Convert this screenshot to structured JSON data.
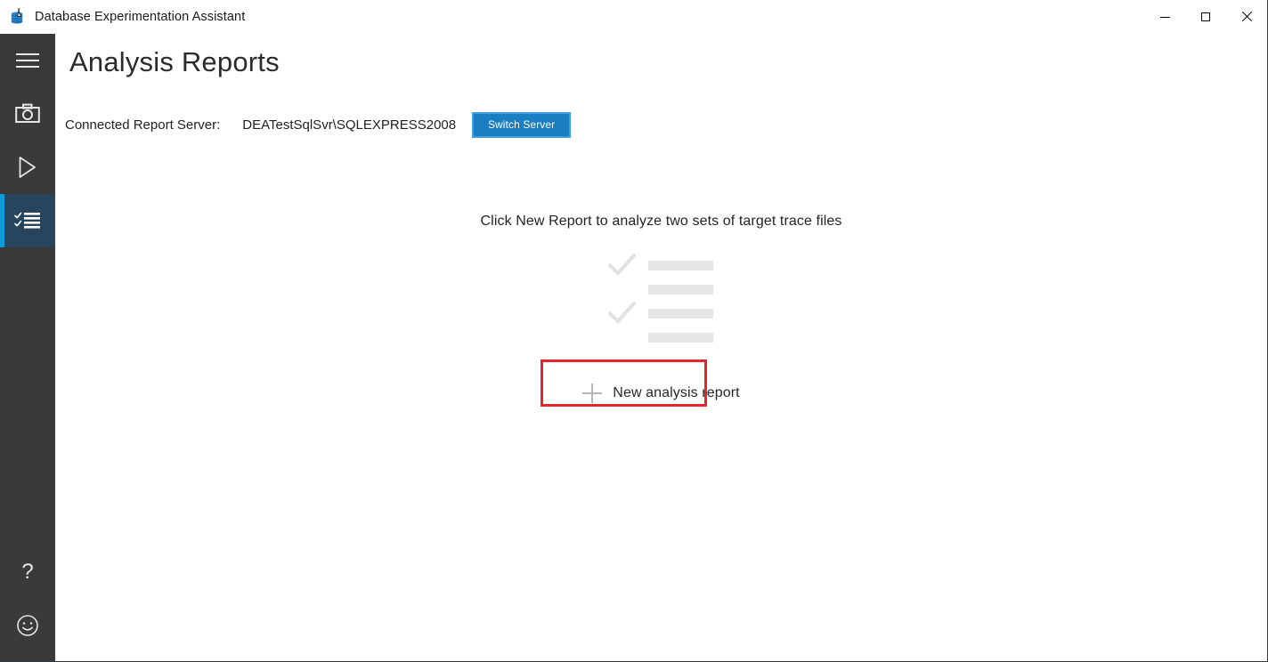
{
  "window": {
    "title": "Database Experimentation Assistant",
    "app_icon": "database-flask-icon",
    "controls": {
      "minimize": "minimize-icon",
      "maximize": "maximize-icon",
      "close": "close-icon"
    }
  },
  "sidebar": {
    "background_color": "#3a3a3a",
    "accent_color": "#0f9ad8",
    "selected_background": "#27455c",
    "items": [
      {
        "id": "menu",
        "icon": "hamburger-menu-icon",
        "selected": false
      },
      {
        "id": "capture",
        "icon": "camera-icon",
        "selected": false
      },
      {
        "id": "replay",
        "icon": "play-icon",
        "selected": false
      },
      {
        "id": "reports",
        "icon": "checklist-icon",
        "selected": true
      }
    ],
    "bottom_items": [
      {
        "id": "help",
        "icon": "question-mark-icon"
      },
      {
        "id": "feedback",
        "icon": "smiley-face-icon"
      }
    ]
  },
  "page": {
    "title": "Analysis Reports"
  },
  "server": {
    "label": "Connected Report Server:",
    "value": "DEATestSqlSvr\\SQLEXPRESS2008",
    "switch_button_label": "Switch Server",
    "switch_button_color": "#1b7ec2",
    "switch_button_border_color": "#3f9fe0"
  },
  "empty_state": {
    "hint": "Click New Report to analyze two sets of target trace files",
    "placeholder_bars": 4,
    "placeholder_checks": 2,
    "placeholder_color": "#e6e6e6"
  },
  "new_report": {
    "label": "New analysis report",
    "icon": "plus-icon",
    "annotation_color": "#e8252a"
  }
}
